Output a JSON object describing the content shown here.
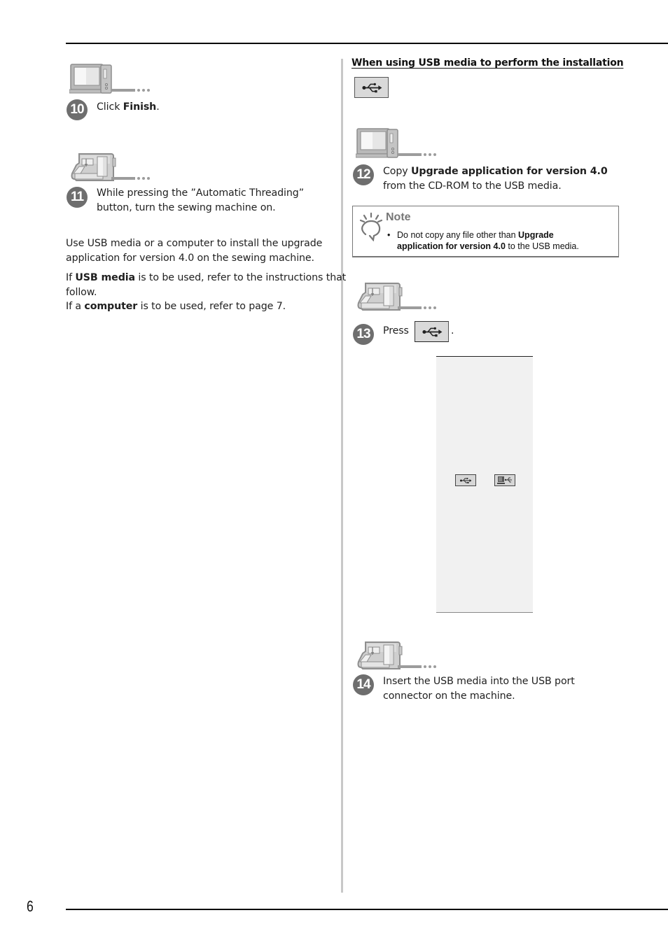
{
  "page": {
    "number": "6"
  },
  "left_column": {
    "steps": [
      {
        "num": "10",
        "icon": "computer-icon",
        "prefix": "Click ",
        "bold": "Finish",
        "suffix": "."
      },
      {
        "num": "11",
        "icon": "sewing-machine-icon",
        "line1": "While pressing the ”Automatic Threading”",
        "line2": "button, turn the sewing machine on."
      }
    ],
    "paragraph1": {
      "line1": "Use USB media or a computer to install the upgrade",
      "line2": "application for version 4.0 on the sewing machine."
    },
    "paragraph2": {
      "p1_prefix": "If ",
      "p1_bold": "USB media",
      "p1_suffix": " is to be used, refer to the instructions that",
      "p1_line2": "follow.",
      "p2_prefix": "If a ",
      "p2_bold": "computer",
      "p2_suffix": " is to be used, refer to page 7."
    }
  },
  "right_column": {
    "heading": "When using USB media to perform the installation",
    "heading_icon": "usb-icon",
    "steps": [
      {
        "num": "12",
        "icon": "computer-icon",
        "prefix": "Copy ",
        "bold": "Upgrade application for version 4.0",
        "line2": "from the CD-ROM to the USB media."
      },
      {
        "num": "13",
        "icon": "sewing-machine-icon",
        "prefix": "Press",
        "button_icon": "usb-icon",
        "suffix": "."
      },
      {
        "num": "14",
        "icon": "sewing-machine-icon",
        "line1": "Insert the USB media into the USB port",
        "line2": "connector on the machine."
      }
    ],
    "note": {
      "title": "Note",
      "bullet": "•",
      "prefix": "Do not copy any file other than ",
      "bold1": "Upgrade",
      "bold2": "application for version 4.0",
      "suffix": " to the USB media."
    },
    "screen": {
      "buttons": [
        {
          "icon": "usb-icon"
        },
        {
          "icon": "computer-usb-icon"
        }
      ]
    }
  },
  "colors": {
    "step_circle": "#6e6e6e",
    "icon_gray": "#999999",
    "note_title": "#777777",
    "screen_bg": "#f1f1f1",
    "button_bg": "#d9d9d9"
  }
}
